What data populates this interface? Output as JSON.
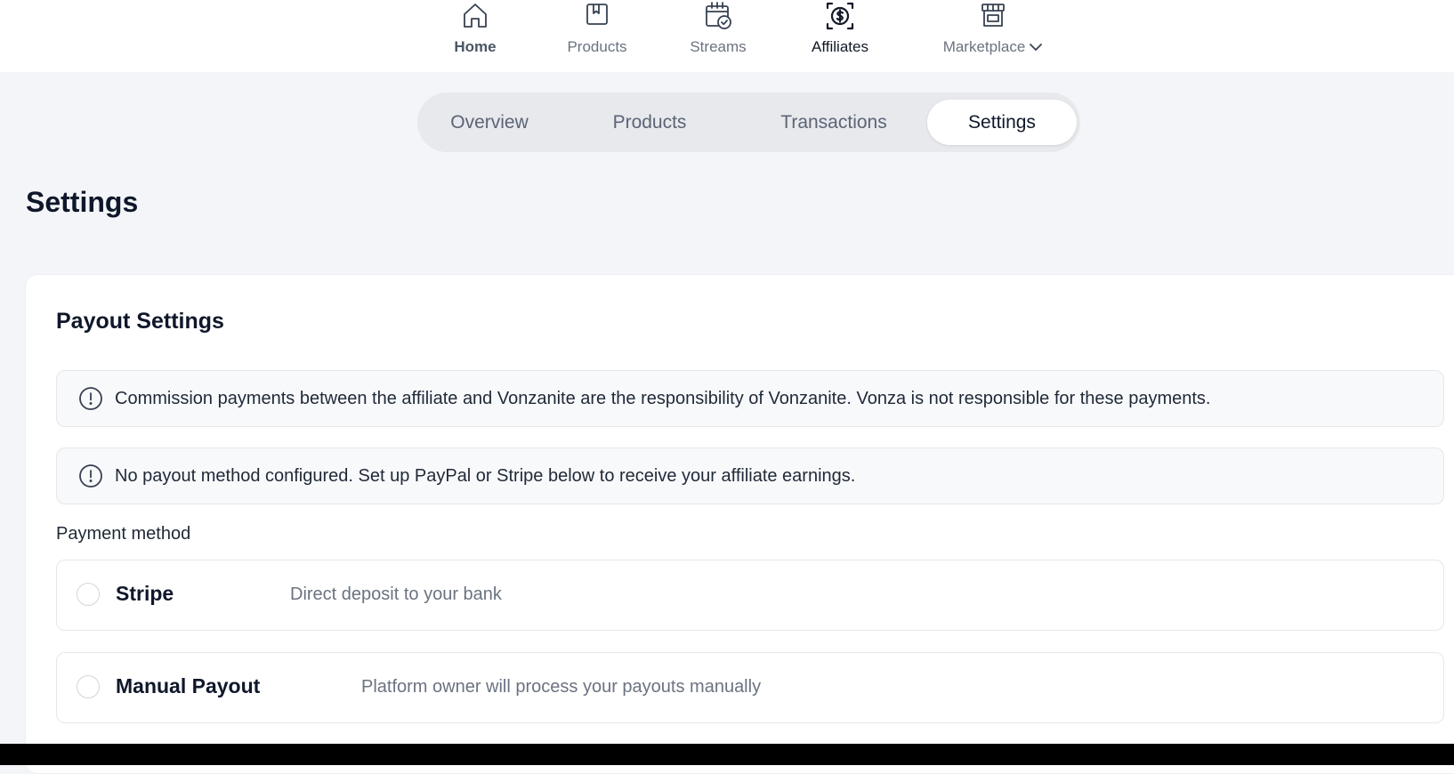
{
  "nav": {
    "items": [
      {
        "label": "Home",
        "icon": "home-icon"
      },
      {
        "label": "Products",
        "icon": "bookmark-book-icon"
      },
      {
        "label": "Streams",
        "icon": "calendar-check-icon"
      },
      {
        "label": "Affiliates",
        "icon": "dollar-target-icon"
      },
      {
        "label": "Marketplace",
        "icon": "storefront-icon"
      }
    ]
  },
  "tabs": [
    {
      "label": "Overview"
    },
    {
      "label": "Products"
    },
    {
      "label": "Transactions"
    },
    {
      "label": "Settings"
    }
  ],
  "page": {
    "title": "Settings"
  },
  "payout": {
    "title": "Payout Settings",
    "notices": [
      "Commission payments between the affiliate and Vonzanite are the responsibility of Vonzanite. Vonza is not responsible for these payments.",
      "No payout method configured. Set up PayPal or Stripe below to receive your affiliate earnings."
    ],
    "payment_method_label": "Payment method",
    "methods": [
      {
        "name": "Stripe",
        "description": "Direct deposit to your bank"
      },
      {
        "name": "Manual Payout",
        "description": "Platform owner will process your payouts manually"
      }
    ]
  },
  "colors": {
    "background": "#f4f5f8",
    "card": "#ffffff",
    "text_primary": "#0f172a",
    "text_muted": "#6b7280",
    "tab_track": "#e8e9ed"
  }
}
